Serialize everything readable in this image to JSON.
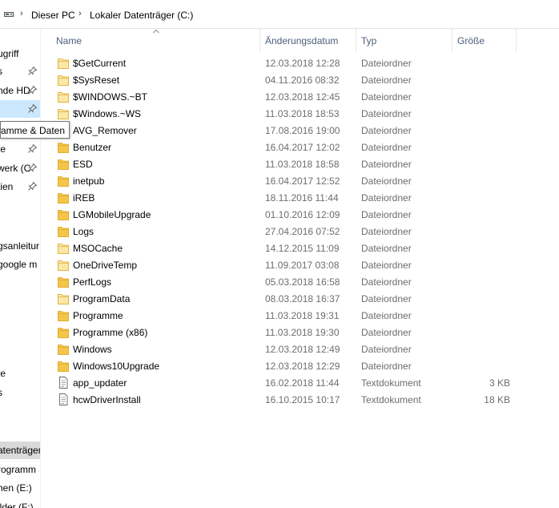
{
  "address": {
    "drive_icon": "drive-icon",
    "separator": "›",
    "crumbs": [
      "Dieser PC",
      "Lokaler Datenträger (C:)"
    ]
  },
  "nav": {
    "items": [
      {
        "label": "ugriff",
        "pinned": false
      },
      {
        "label": "s",
        "pinned": true
      },
      {
        "label": "nde HD",
        "pinned": true
      },
      {
        "label": "",
        "pinned": true
      },
      {
        "label": "te",
        "pinned": true
      },
      {
        "label": "werk (C",
        "pinned": true
      },
      {
        "label": "tien",
        "pinned": true
      },
      {
        "label": "gsanleitur",
        "pinned": false
      },
      {
        "label": "google m",
        "pinned": false
      },
      {
        "label": "te",
        "pinned": false
      },
      {
        "label": "s",
        "pinned": false
      },
      {
        "label": "atenträger",
        "pinned": false
      },
      {
        "label": "rogramm",
        "pinned": false
      },
      {
        "label": "hen (E:)",
        "pinned": false
      },
      {
        "label": "ilder (F:)",
        "pinned": false
      }
    ],
    "tooltip": "ramme & Daten"
  },
  "columns": {
    "name": "Name",
    "date": "Änderungsdatum",
    "type": "Typ",
    "size": "Größe"
  },
  "files": [
    {
      "name": "$GetCurrent",
      "date": "12.03.2018 12:28",
      "type": "Dateiordner",
      "size": "",
      "kind": "folder-faded"
    },
    {
      "name": "$SysReset",
      "date": "04.11.2016 08:32",
      "type": "Dateiordner",
      "size": "",
      "kind": "folder-faded"
    },
    {
      "name": "$WINDOWS.~BT",
      "date": "12.03.2018 12:45",
      "type": "Dateiordner",
      "size": "",
      "kind": "folder-faded"
    },
    {
      "name": "$Windows.~WS",
      "date": "11.03.2018 18:53",
      "type": "Dateiordner",
      "size": "",
      "kind": "folder-faded"
    },
    {
      "name": "AVG_Remover",
      "date": "17.08.2016 19:00",
      "type": "Dateiordner",
      "size": "",
      "kind": "folder"
    },
    {
      "name": "Benutzer",
      "date": "16.04.2017 12:02",
      "type": "Dateiordner",
      "size": "",
      "kind": "folder"
    },
    {
      "name": "ESD",
      "date": "11.03.2018 18:58",
      "type": "Dateiordner",
      "size": "",
      "kind": "folder"
    },
    {
      "name": "inetpub",
      "date": "16.04.2017 12:52",
      "type": "Dateiordner",
      "size": "",
      "kind": "folder"
    },
    {
      "name": "iREB",
      "date": "18.11.2016 11:44",
      "type": "Dateiordner",
      "size": "",
      "kind": "folder"
    },
    {
      "name": "LGMobileUpgrade",
      "date": "01.10.2016 12:09",
      "type": "Dateiordner",
      "size": "",
      "kind": "folder"
    },
    {
      "name": "Logs",
      "date": "27.04.2016 07:52",
      "type": "Dateiordner",
      "size": "",
      "kind": "folder"
    },
    {
      "name": "MSOCache",
      "date": "14.12.2015 11:09",
      "type": "Dateiordner",
      "size": "",
      "kind": "folder-faded"
    },
    {
      "name": "OneDriveTemp",
      "date": "11.09.2017 03:08",
      "type": "Dateiordner",
      "size": "",
      "kind": "folder-faded"
    },
    {
      "name": "PerfLogs",
      "date": "05.03.2018 16:58",
      "type": "Dateiordner",
      "size": "",
      "kind": "folder"
    },
    {
      "name": "ProgramData",
      "date": "08.03.2018 16:37",
      "type": "Dateiordner",
      "size": "",
      "kind": "folder-faded"
    },
    {
      "name": "Programme",
      "date": "11.03.2018 19:31",
      "type": "Dateiordner",
      "size": "",
      "kind": "folder"
    },
    {
      "name": "Programme (x86)",
      "date": "11.03.2018 19:30",
      "type": "Dateiordner",
      "size": "",
      "kind": "folder"
    },
    {
      "name": "Windows",
      "date": "12.03.2018 12:49",
      "type": "Dateiordner",
      "size": "",
      "kind": "folder"
    },
    {
      "name": "Windows10Upgrade",
      "date": "12.03.2018 12:29",
      "type": "Dateiordner",
      "size": "",
      "kind": "folder"
    },
    {
      "name": "app_updater",
      "date": "16.02.2018 11:44",
      "type": "Textdokument",
      "size": "3 KB",
      "kind": "text-file"
    },
    {
      "name": "hcwDriverInstall",
      "date": "16.10.2015 10:17",
      "type": "Textdokument",
      "size": "18 KB",
      "kind": "text-file"
    }
  ],
  "colors": {
    "folder": "#f4c54a",
    "folder_faded": "#fbe7a7",
    "selection": "#cce8ff",
    "header_text": "#4c607a",
    "secondary_text": "#6d6d6d"
  }
}
